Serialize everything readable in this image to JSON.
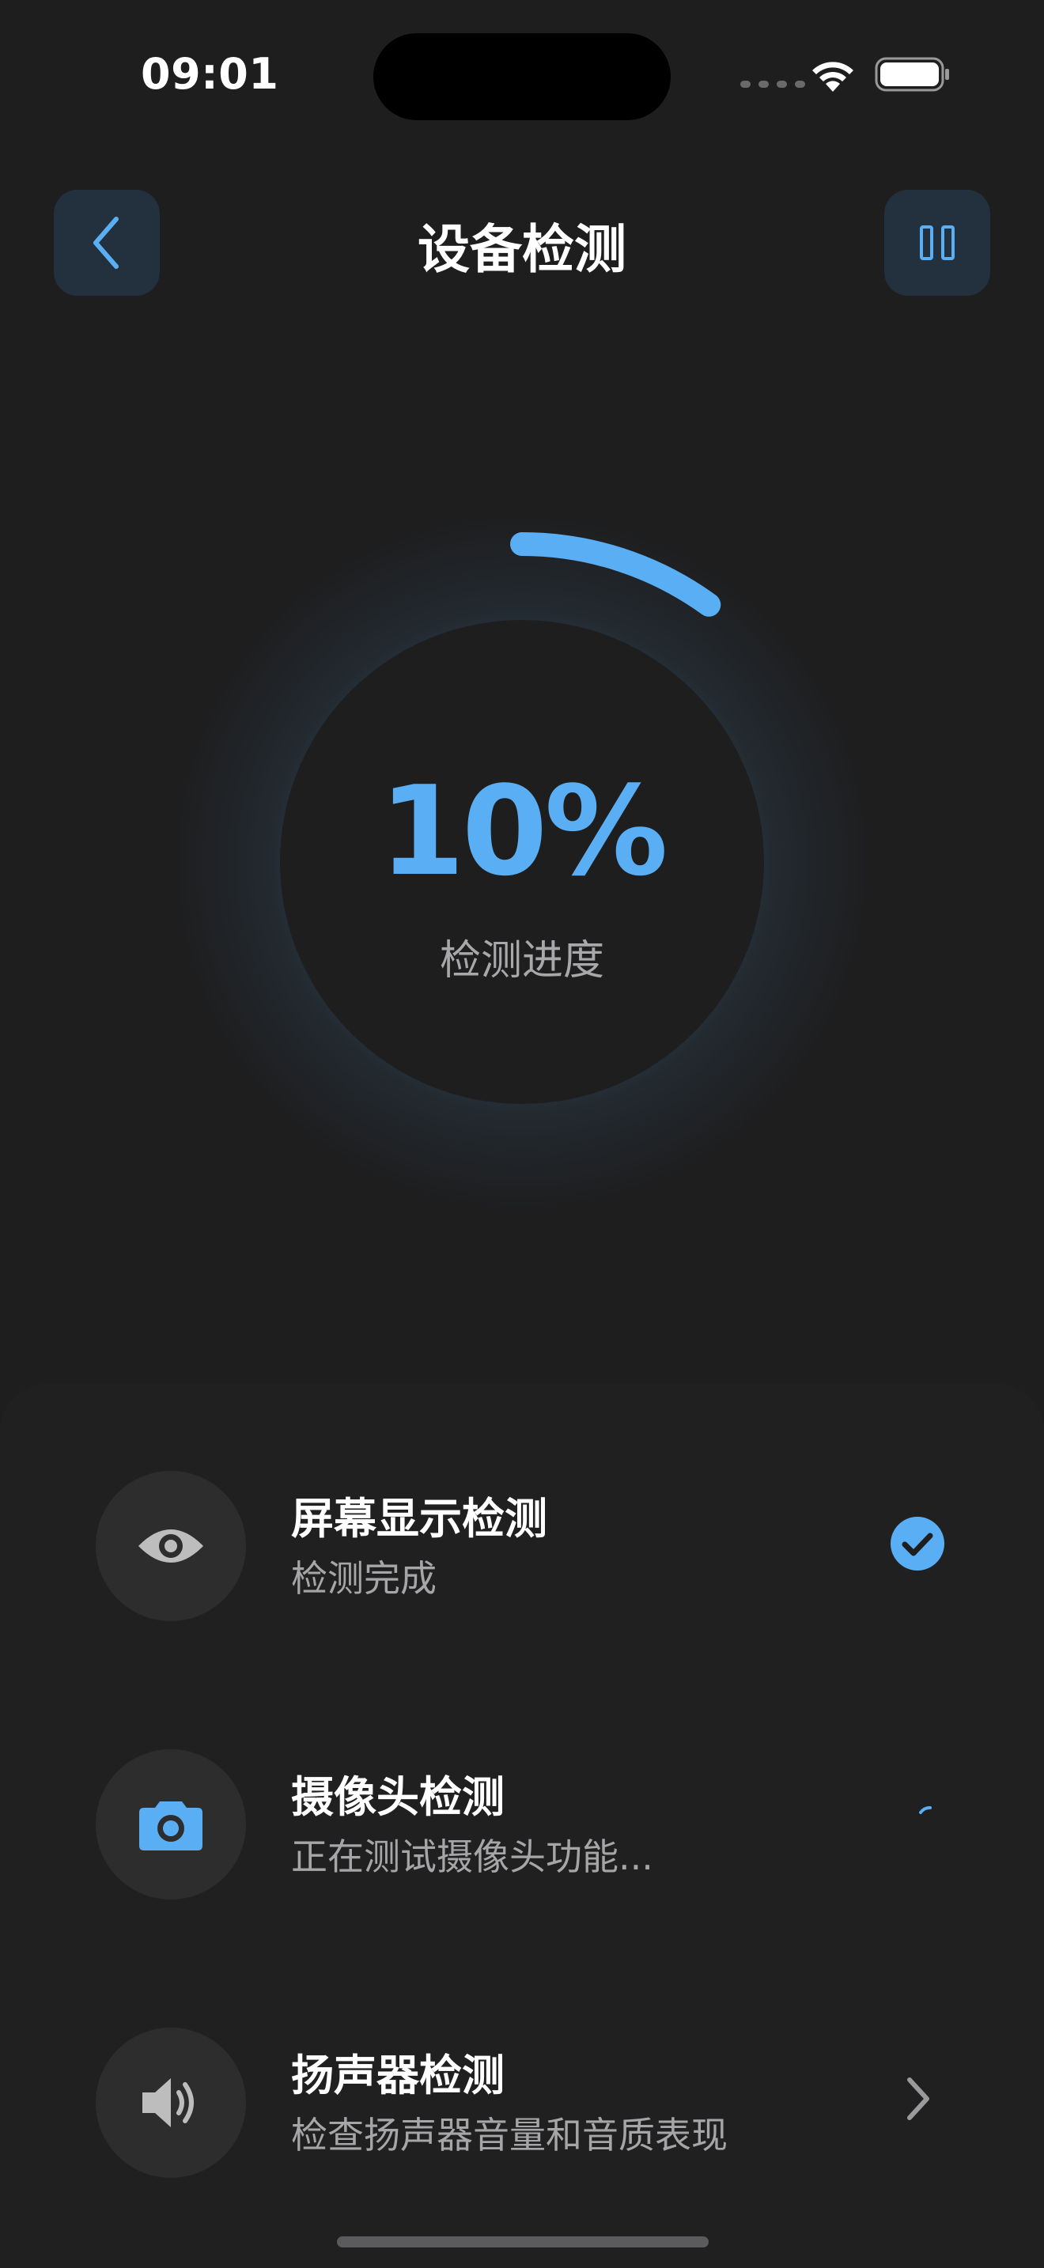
{
  "status_bar": {
    "time": "09:01",
    "icons": [
      "signal-icon",
      "wifi-icon",
      "battery-icon"
    ]
  },
  "header": {
    "title": "设备检测",
    "back_icon": "chevron-left-icon",
    "pause_icon": "pause-icon"
  },
  "progress": {
    "value_text": "10%",
    "value": 0.1,
    "label": "检测进度"
  },
  "tests": [
    {
      "title": "屏幕显示检测",
      "subtitle": "检测完成",
      "icon": "eye-icon",
      "status": "completed",
      "status_icon": "check-circle-icon"
    },
    {
      "title": "摄像头检测",
      "subtitle": "正在测试摄像头功能...",
      "icon": "camera-icon",
      "status": "in-progress",
      "status_icon": "spinner-icon"
    },
    {
      "title": "扬声器检测",
      "subtitle": "检查扬声器音量和音质表现",
      "icon": "speaker-icon",
      "status": "pending",
      "status_icon": "chevron-right-icon"
    }
  ],
  "colors": {
    "accent": "#5aaef3",
    "background": "#1e1e1f",
    "button_bg": "#23303d",
    "muted_text": "#a8a8aa"
  }
}
